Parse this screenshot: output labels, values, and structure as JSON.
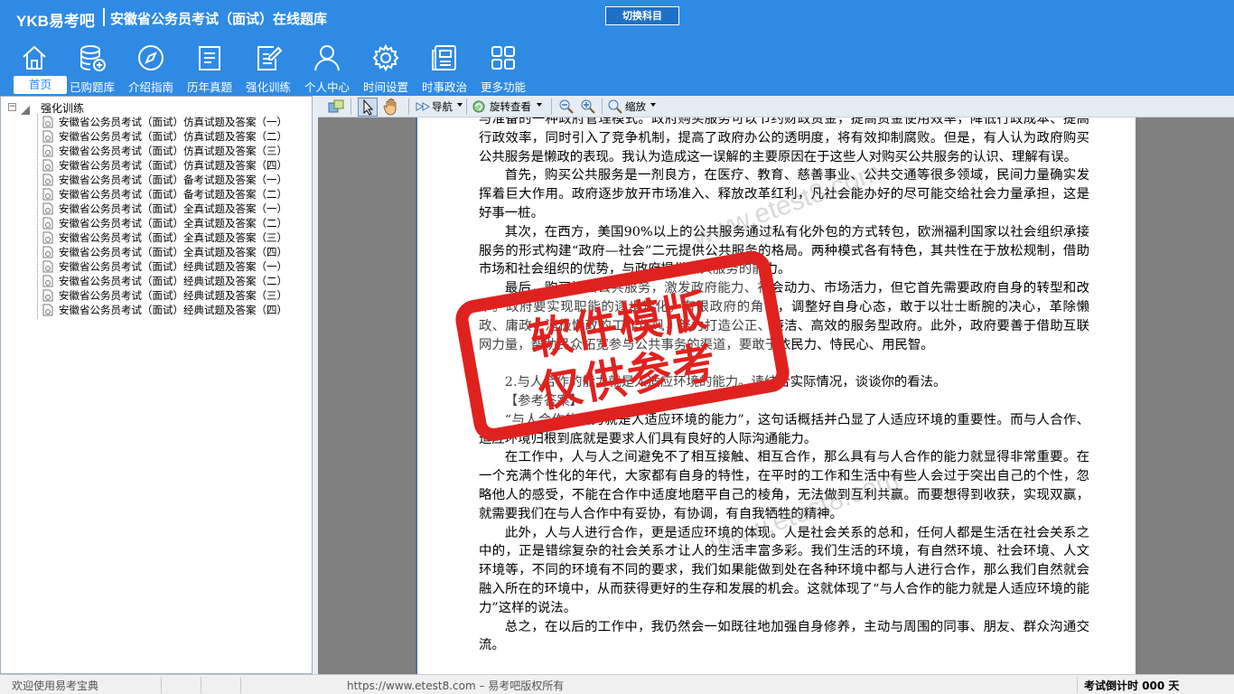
{
  "header": {
    "brand": "YKB易考吧",
    "app_title": "安徽省公务员考试（面试）在线题库",
    "switch_button": "切换科目"
  },
  "nav": [
    {
      "label": "首页",
      "icon": "home-icon"
    },
    {
      "label": "已购题库",
      "icon": "database-add-icon"
    },
    {
      "label": "介绍指南",
      "icon": "compass-icon"
    },
    {
      "label": "历年真题",
      "icon": "document-list-icon"
    },
    {
      "label": "强化训练",
      "icon": "edit-document-icon"
    },
    {
      "label": "个人中心",
      "icon": "user-icon"
    },
    {
      "label": "时间设置",
      "icon": "gear-icon"
    },
    {
      "label": "时事政治",
      "icon": "newspaper-icon"
    },
    {
      "label": "更多功能",
      "icon": "grid-icon"
    }
  ],
  "tree": {
    "root": "强化训练",
    "expander": "−",
    "items": [
      "安徽省公务员考试（面试）仿真试题及答案（一）",
      "安徽省公务员考试（面试）仿真试题及答案（二）",
      "安徽省公务员考试（面试）仿真试题及答案（三）",
      "安徽省公务员考试（面试）仿真试题及答案（四）",
      "安徽省公务员考试（面试）备考试题及答案（一）",
      "安徽省公务员考试（面试）备考试题及答案（二）",
      "安徽省公务员考试（面试）全真试题及答案（一）",
      "安徽省公务员考试（面试）全真试题及答案（二）",
      "安徽省公务员考试（面试）全真试题及答案（三）",
      "安徽省公务员考试（面试）全真试题及答案（四）",
      "安徽省公务员考试（面试）经典试题及答案（一）",
      "安徽省公务员考试（面试）经典试题及答案（二）",
      "安徽省公务员考试（面试）经典试题及答案（三）",
      "安徽省公务员考试（面试）经典试题及答案（四）"
    ]
  },
  "toolbar": {
    "navigate": "导航",
    "rotate": "旋转查看",
    "zoom": "缩放"
  },
  "document": {
    "paragraphs": [
      {
        "indent": false,
        "text": "与准备的一种政府管理模式。政府购买服务可以节约财政资金，提高资金使用效率，降低行政成本、提高行政效率，同时引入了竞争机制，提高了政府办公的透明度，将有效抑制腐败。但是，有人认为政府购买公共服务是懒政的表现。我认为造成这一误解的主要原因在于这些人对购买公共服务的认识、理解有误。"
      },
      {
        "indent": true,
        "text": "首先，购买公共服务是一剂良方，在医疗、教育、慈善事业、公共交通等很多领域，民间力量确实发挥着巨大作用。政府逐步放开市场准入、释放改革红利，凡社会能办好的尽可能交给社会力量承担，这是好事一桩。"
      },
      {
        "indent": true,
        "text": "其次，在西方，美国90%以上的公共服务通过私有化外包的方式转包，欧洲福利国家以社会组织承接服务的形式构建“政府—社会”二元提供公共服务的格局。两种模式各有特色，其共性在于放松规制，借助市场和社会组织的优势，与政府提供公共服务的能力。"
      },
      {
        "indent": true,
        "text": "最后，购买社会公共服务，激发政府能力、社会动力、市场活力，但它首先需要政府自身的转型和改革。政府要实现职能的逐步转化，有限政府的角色，调整好自身心态，敢于以壮士断腕的决心，革除懒政、庸政，消极懒政的工作作风，努力打造公正、廉洁、高效的服务型政府。此外，政府要善于借助互联网力量，帮助民众拓宽参与公共事务的渠道，要敢于依民力、恃民心、用民智。"
      },
      {
        "indent": false,
        "text": " "
      },
      {
        "indent": true,
        "text": "2.与人合作的能力就是人适应环境的能力。请结合实际情况，谈谈你的看法。"
      },
      {
        "indent": true,
        "text": "【参考答案】"
      },
      {
        "indent": true,
        "text": "“与人合作的能力就是人适应环境的能力”，这句话概括并凸显了人适应环境的重要性。而与人合作、适应环境归根到底就是要求人们具有良好的人际沟通能力。"
      },
      {
        "indent": true,
        "text": "在工作中，人与人之间避免不了相互接触、相互合作，那么具有与人合作的能力就显得非常重要。在一个充满个性化的年代，大家都有自身的特性，在平时的工作和生活中有些人会过于突出自己的个性，忽略他人的感受，不能在合作中适度地磨平自己的棱角，无法做到互利共赢。而要想得到收获，实现双赢，就需要我们在与人合作中有妥协，有协调，有自我牺牲的精神。"
      },
      {
        "indent": true,
        "text": "此外，人与人进行合作，更是适应环境的体现。人是社会关系的总和，任何人都是生活在社会关系之中的，正是错综复杂的社会关系才让人的生活丰富多彩。我们生活的环境，有自然环境、社会环境、人文环境等，不同的环境有不同的要求，我们如果能做到处在各种环境中都与人进行合作，那么我们自然就会融入所在的环境中，从而获得更好的生存和发展的机会。这就体现了“与人合作的能力就是人适应环境的能力”这样的说法。"
      },
      {
        "indent": true,
        "text": "总之，在以后的工作中，我仍然会一如既往地加强自身修养，主动与周围的同事、朋友、群众沟通交流。"
      }
    ]
  },
  "watermark": {
    "line1": "软件模版",
    "line2": "仅供参考",
    "site": "www.etest8.com",
    "color": "#e0221f"
  },
  "status": {
    "left": "欢迎使用易考宝典",
    "middle": "https://www.etest8.com – 易考吧版权所有",
    "right": "考试倒计时 000 天"
  },
  "colors": {
    "header_bg": "#2f8ae4",
    "active_tab_text": "#2f8ae4"
  }
}
